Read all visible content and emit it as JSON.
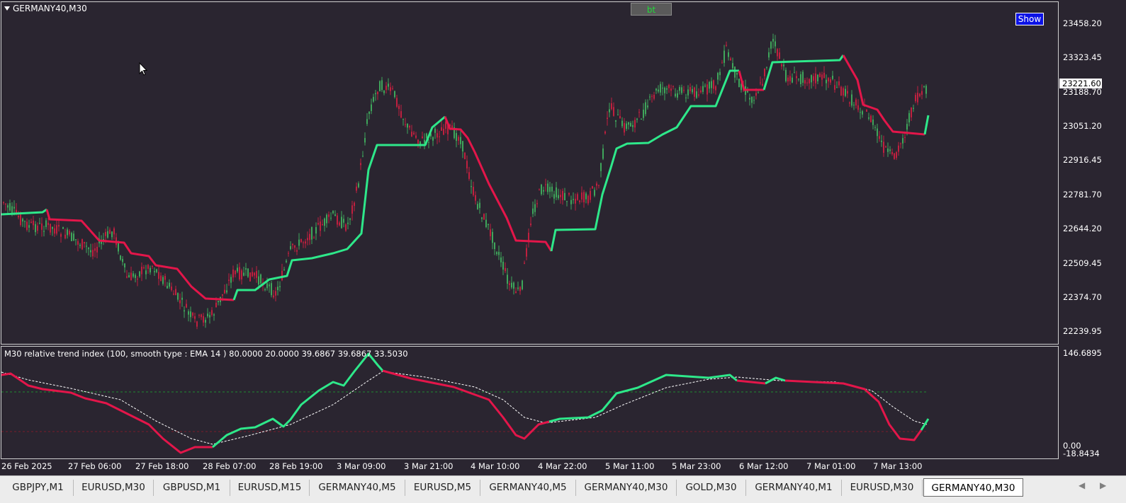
{
  "chart": {
    "symbol": "GERMANY40,M30",
    "bt_label": "bt",
    "show_label": "Show",
    "current_price": "23221.60",
    "price_ticks": [
      "23458.20",
      "23323.45",
      "23188.70",
      "23051.20",
      "22916.45",
      "22781.70",
      "22644.20",
      "22509.45",
      "22374.70",
      "22239.95"
    ],
    "indicator_label": "M30 relative trend index (100, smooth type : EMA  14 ) 80.0000 20.0000 39.6867 39.6867 33.5030",
    "indicator_ticks": [
      "146.6895",
      "0.00",
      "-18.8434"
    ],
    "time_ticks": [
      "26 Feb 2025",
      "27 Feb 06:00",
      "27 Feb 18:00",
      "28 Feb 07:00",
      "28 Feb 19:00",
      "3 Mar 09:00",
      "3 Mar 21:00",
      "4 Mar 10:00",
      "4 Mar 22:00",
      "5 Mar 11:00",
      "5 Mar 23:00",
      "6 Mar 12:00",
      "7 Mar 01:00",
      "7 Mar 13:00"
    ],
    "colors": {
      "background": "#2a2530",
      "bull": "#2ee88a",
      "bear": "#e3164a",
      "bull_candle": "#3fa65b",
      "bear_candle": "#c0203f"
    }
  },
  "tabs": [
    {
      "label": "GBPJPY,M1"
    },
    {
      "label": "EURUSD,M30"
    },
    {
      "label": "GBPUSD,M1"
    },
    {
      "label": "EURUSD,M15"
    },
    {
      "label": "GERMANY40,M5"
    },
    {
      "label": "EURUSD,M5"
    },
    {
      "label": "GERMANY40,M5"
    },
    {
      "label": "GERMANY40,M30"
    },
    {
      "label": "GOLD,M30"
    },
    {
      "label": "GERMANY40,M1"
    },
    {
      "label": "EURUSD,M30"
    },
    {
      "label": "GERMANY40,M30",
      "active": true
    }
  ],
  "scroll": {
    "left_icon": "scroll-left-icon",
    "right_icon": "scroll-right-icon"
  }
}
